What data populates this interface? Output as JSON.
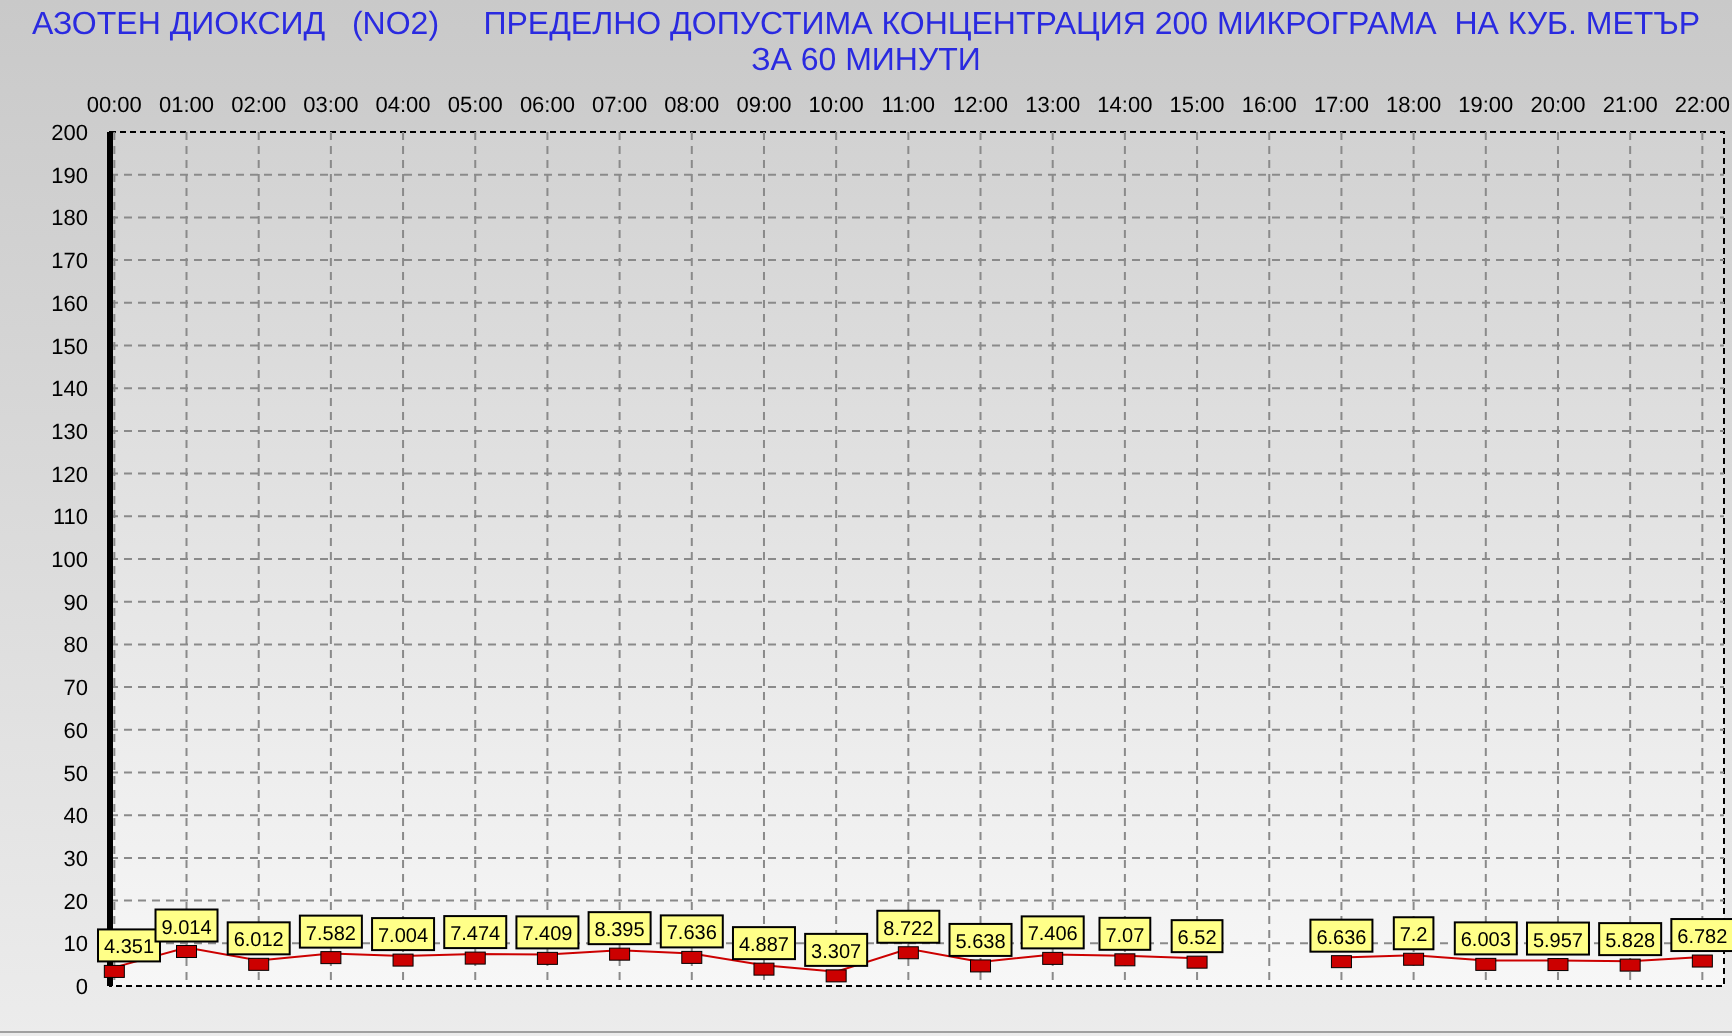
{
  "chart": {
    "chart_data": {
      "type": "line",
      "title": "АЗОТЕН ДИОКСИД   (NO2)     ПРЕДЕЛНО ДОПУСТИМА КОНЦЕНТРАЦИЯ 200 МИКРОГРАМА  НА КУБ. МЕТЪР\nЗА 60 МИНУТИ",
      "categories": [
        "00:00",
        "01:00",
        "02:00",
        "03:00",
        "04:00",
        "05:00",
        "06:00",
        "07:00",
        "08:00",
        "09:00",
        "10:00",
        "11:00",
        "12:00",
        "13:00",
        "14:00",
        "15:00",
        "16:00",
        "17:00",
        "18:00",
        "19:00",
        "20:00",
        "21:00",
        "22:00"
      ],
      "series": [
        {
          "color": "#cc0000",
          "values": [
            4.351,
            9.014,
            6.012,
            7.582,
            7.004,
            7.474,
            7.409,
            8.395,
            7.636,
            4.887,
            3.307,
            8.722,
            5.638,
            7.406,
            7.07,
            6.52,
            null,
            6.636,
            7.2,
            6.003,
            5.957,
            5.828,
            6.782
          ]
        }
      ],
      "ylim": [
        0,
        200
      ],
      "yticks": [
        0,
        10,
        20,
        30,
        40,
        50,
        60,
        70,
        80,
        90,
        100,
        110,
        120,
        130,
        140,
        150,
        160,
        170,
        180,
        190,
        200
      ],
      "data_labels": true,
      "grid": true
    }
  }
}
